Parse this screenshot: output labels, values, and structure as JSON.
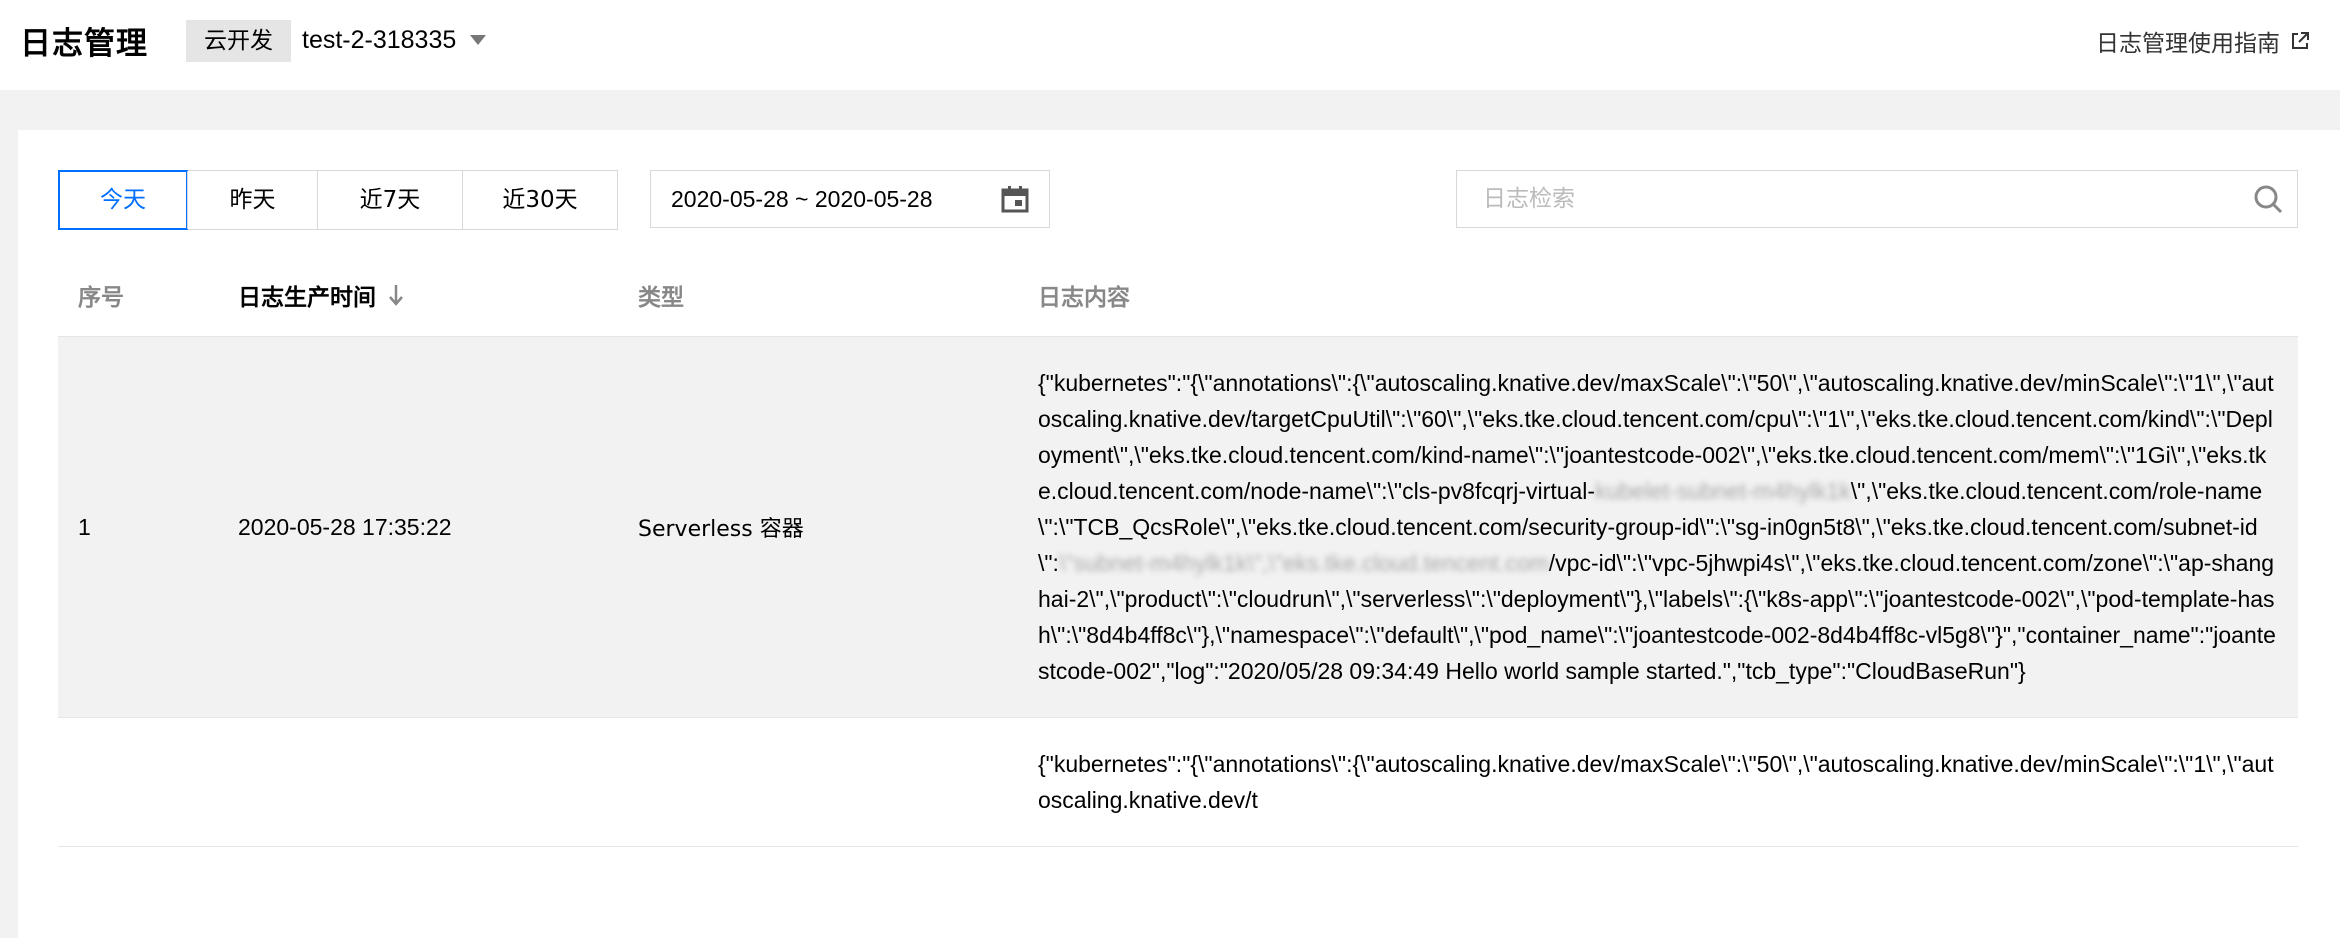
{
  "header": {
    "title": "日志管理",
    "env_tag": "云开发",
    "env_name": "test-2-318335",
    "guide_link": "日志管理使用指南"
  },
  "toolbar": {
    "ranges": [
      "今天",
      "昨天",
      "近7天",
      "近30天"
    ],
    "active_range": "今天",
    "date_range": "2020-05-28 ~ 2020-05-28",
    "search_placeholder": "日志检索"
  },
  "table": {
    "columns": {
      "no": "序号",
      "time": "日志生产时间",
      "type": "类型",
      "content": "日志内容"
    },
    "rows": [
      {
        "no": "1",
        "time": "2020-05-28 17:35:22",
        "type": "Serverless 容器",
        "content_part1": "{\"kubernetes\":\"{\\\"annotations\\\":{\\\"autoscaling.knative.dev/maxScale\\\":\\\"50\\\",\\\"autoscaling.knative.dev/minScale\\\":\\\"1\\\",\\\"autoscaling.knative.dev/targetCpuUtil\\\":\\\"60\\\",\\\"eks.tke.cloud.tencent.com/cpu\\\":\\\"1\\\",\\\"eks.tke.cloud.tencent.com/kind\\\":\\\"Deployment\\\",\\\"eks.tke.cloud.tencent.com/kind-name\\\":\\\"joantestcode-002\\\",\\\"eks.tke.cloud.tencent.com/mem\\\":\\\"1Gi\\\",\\\"eks.tke.cloud.tencent.com/node-name\\\":\\\"cls-pv8fcqrj-virtual-",
        "content_blur1": "kubelet-subnet-m4hylk1k",
        "content_part2": "\\\",\\\"eks.tke.cloud.tencent.com/role-name\\\":\\\"TCB_QcsRole\\\",\\\"eks.tke.cloud.tencent.com/security-group-id\\\":\\\"sg-in0gn5t8\\\",\\\"eks.tke.cloud.tencent.com/subnet-id\\\":",
        "content_blur2": "\\\"subnet-m4hylk1k\\\",\\\"eks.tke.cloud.tencent.com",
        "content_part3": "/vpc-id\\\":\\\"vpc-5jhwpi4s\\\",\\\"eks.tke.cloud.tencent.com/zone\\\":\\\"ap-shanghai-2\\\",\\\"product\\\":\\\"cloudrun\\\",\\\"serverless\\\":\\\"deployment\\\"},\\\"labels\\\":{\\\"k8s-app\\\":\\\"joantestcode-002\\\",\\\"pod-template-hash\\\":\\\"8d4b4ff8c\\\"},\\\"namespace\\\":\\\"default\\\",\\\"pod_name\\\":\\\"joantestcode-002-8d4b4ff8c-vl5g8\\\"}\",\"container_name\":\"joantestcode-002\",\"log\":\"2020/05/28 09:34:49 Hello world sample started.\",\"tcb_type\":\"CloudBaseRun\"}"
      },
      {
        "no": "",
        "time": "",
        "type": "",
        "content_part1": "{\"kubernetes\":\"{\\\"annotations\\\":{\\\"autoscaling.knative.dev/maxScale\\\":\\\"50\\\",\\\"autoscaling.knative.dev/minScale\\\":\\\"1\\\",\\\"autoscaling.knative.dev/t"
      }
    ]
  }
}
